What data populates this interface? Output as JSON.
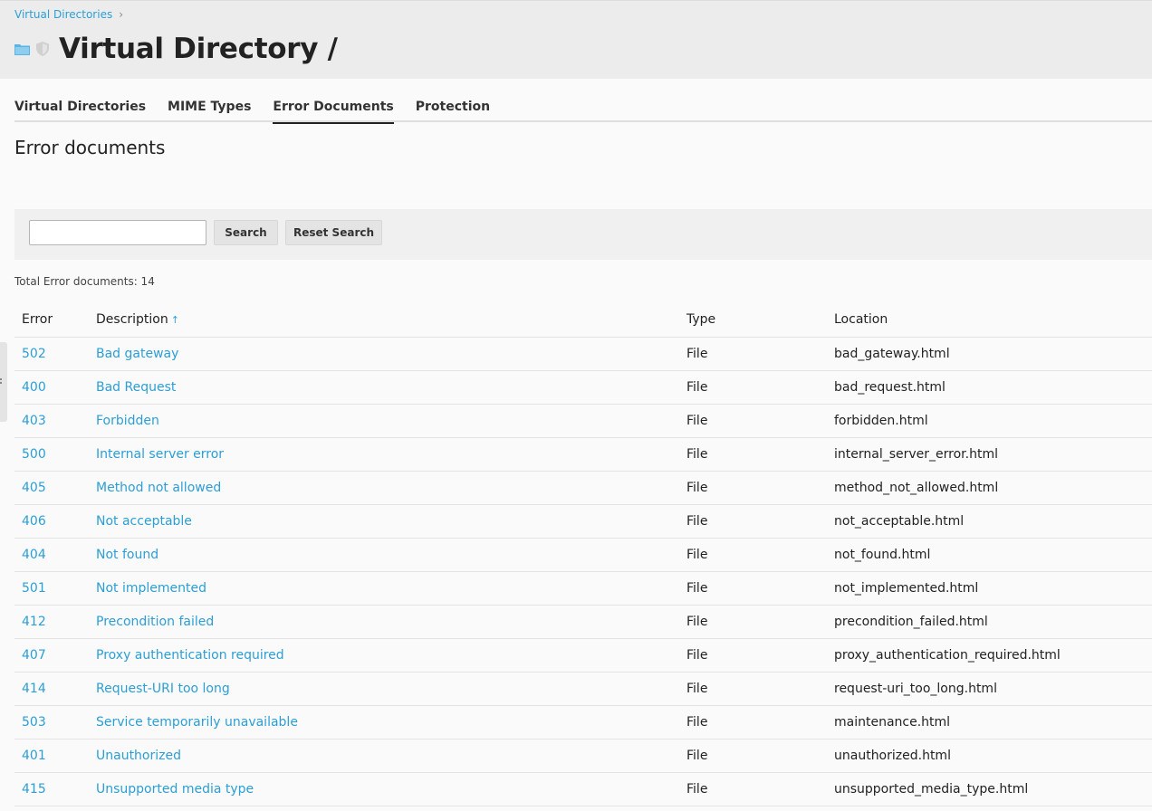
{
  "breadcrumb": {
    "label": "Virtual Directories",
    "separator": "›"
  },
  "page_title": "Virtual Directory /",
  "tabs": [
    {
      "label": "Virtual Directories",
      "active": false
    },
    {
      "label": "MIME Types",
      "active": false
    },
    {
      "label": "Error Documents",
      "active": true
    },
    {
      "label": "Protection",
      "active": false
    }
  ],
  "section_title": "Error documents",
  "search": {
    "value": "",
    "placeholder": "",
    "search_label": "Search",
    "reset_label": "Reset Search"
  },
  "total_text": "Total Error documents: 14",
  "table": {
    "headers": {
      "error": "Error",
      "description": "Description",
      "sort_indicator": "↑",
      "type": "Type",
      "location": "Location"
    },
    "rows": [
      {
        "error": "502",
        "description": "Bad gateway",
        "type": "File",
        "location": "bad_gateway.html"
      },
      {
        "error": "400",
        "description": "Bad Request",
        "type": "File",
        "location": "bad_request.html"
      },
      {
        "error": "403",
        "description": "Forbidden",
        "type": "File",
        "location": "forbidden.html"
      },
      {
        "error": "500",
        "description": "Internal server error",
        "type": "File",
        "location": "internal_server_error.html"
      },
      {
        "error": "405",
        "description": "Method not allowed",
        "type": "File",
        "location": "method_not_allowed.html"
      },
      {
        "error": "406",
        "description": "Not acceptable",
        "type": "File",
        "location": "not_acceptable.html"
      },
      {
        "error": "404",
        "description": "Not found",
        "type": "File",
        "location": "not_found.html"
      },
      {
        "error": "501",
        "description": "Not implemented",
        "type": "File",
        "location": "not_implemented.html"
      },
      {
        "error": "412",
        "description": "Precondition failed",
        "type": "File",
        "location": "precondition_failed.html"
      },
      {
        "error": "407",
        "description": "Proxy authentication required",
        "type": "File",
        "location": "proxy_authentication_required.html"
      },
      {
        "error": "414",
        "description": "Request-URI too long",
        "type": "File",
        "location": "request-uri_too_long.html"
      },
      {
        "error": "503",
        "description": "Service temporarily unavailable",
        "type": "File",
        "location": "maintenance.html"
      },
      {
        "error": "401",
        "description": "Unauthorized",
        "type": "File",
        "location": "unauthorized.html"
      },
      {
        "error": "415",
        "description": "Unsupported media type",
        "type": "File",
        "location": "unsupported_media_type.html"
      }
    ]
  },
  "colors": {
    "link": "#2b9fd6",
    "header_bg": "#ececec",
    "page_bg": "#fafafa",
    "folder_icon": "#5ab4e5",
    "shield_icon": "#d0d0d0"
  }
}
